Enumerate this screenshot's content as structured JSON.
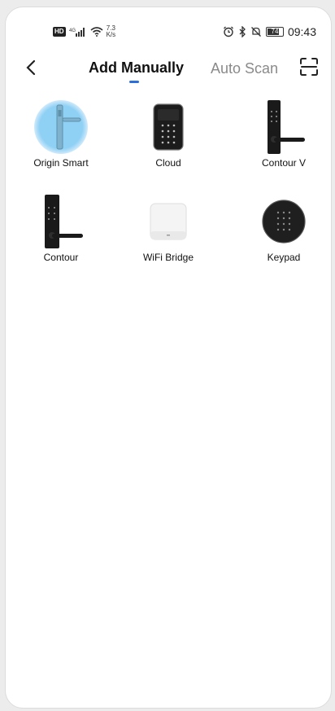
{
  "status_bar": {
    "network_type": "HD",
    "signal": "4G",
    "speed_value": "7.3",
    "speed_unit": "K/s",
    "battery": "74",
    "time": "09:43"
  },
  "header": {
    "active_tab": "Add Manually",
    "other_tab": "Auto Scan"
  },
  "devices": [
    {
      "name": "Origin Smart"
    },
    {
      "name": "Cloud"
    },
    {
      "name": "Contour V"
    },
    {
      "name": "Contour"
    },
    {
      "name": "WiFi Bridge"
    },
    {
      "name": "Keypad"
    }
  ],
  "colors": {
    "accent": "#2a6fdb",
    "selected_highlight": "#8fd0f5"
  }
}
